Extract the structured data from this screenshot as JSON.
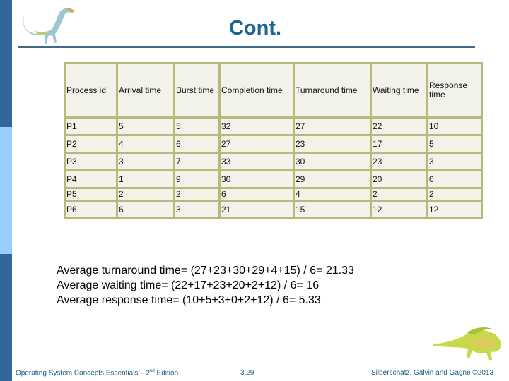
{
  "slide": {
    "title": "Cont.",
    "colors": {
      "sidebar_dark": "#336699",
      "sidebar_light": "#99ccff",
      "title": "#1b6392",
      "rule": "#3f6a8a",
      "table_border": "#b9b878",
      "table_fill": "#f2f1ea",
      "footer_text": "#1d5f8a"
    }
  },
  "table": {
    "headers": [
      "Process id",
      "Arrival time",
      "Burst time",
      "Completion time",
      "Turnaround time",
      "Waiting time",
      "Response time"
    ],
    "rows": [
      [
        "P1",
        "5",
        "5",
        "32",
        "27",
        "22",
        "10"
      ],
      [
        "P2",
        "4",
        "6",
        "27",
        "23",
        "17",
        "5"
      ],
      [
        "P3",
        "3",
        "7",
        "33",
        "30",
        "23",
        "3"
      ],
      [
        "P4",
        "1",
        "9",
        "30",
        "29",
        "20",
        "0"
      ],
      [
        "P5",
        "2",
        "2",
        "6",
        "4",
        "2",
        "2"
      ],
      [
        "P6",
        "6",
        "3",
        "21",
        "15",
        "12",
        "12"
      ]
    ]
  },
  "averages": {
    "turnaround": "Average turnaround time= (27+23+30+29+4+15) / 6= 21.33",
    "waiting": "Average waiting time= (22+17+23+20+2+12) / 6= 16",
    "response": "Average response time= (10+5+3+0+2+12) / 6= 5.33"
  },
  "footer": {
    "book_title": "Operating System Concepts Essentials – 2",
    "edition_sup": "nd",
    "edition_suffix": " Edition",
    "page": "3.29",
    "copyright": "Silberschatz, Galvin and Gagne ©2013"
  },
  "icons": {
    "top_logo": "dinosaur-logo-icon",
    "bottom_logo": "dinosaur-logo-icon"
  }
}
